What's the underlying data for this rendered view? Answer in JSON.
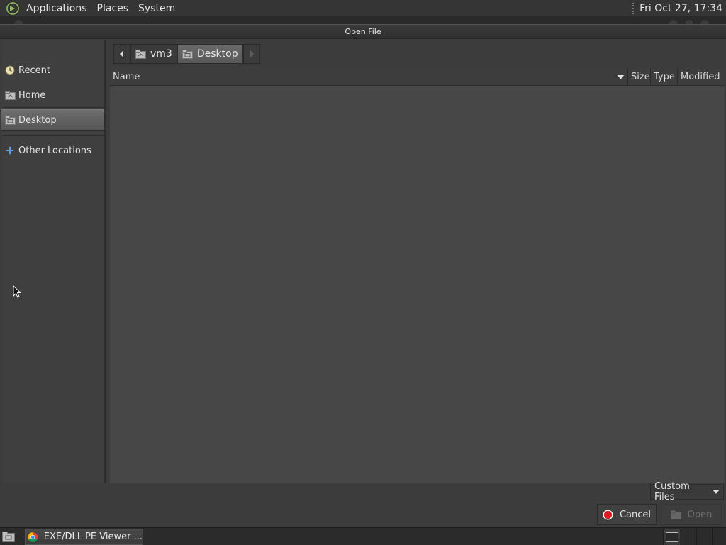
{
  "top_panel": {
    "menus": [
      "Applications",
      "Places",
      "System"
    ],
    "clock": "Fri Oct 27, 17:34"
  },
  "dialog": {
    "title": "Open File",
    "places": [
      {
        "label": "Recent",
        "icon": "recent-icon"
      },
      {
        "label": "Home",
        "icon": "home-folder-icon"
      },
      {
        "label": "Desktop",
        "icon": "desktop-folder-icon",
        "selected": true
      },
      {
        "label": "Other Locations",
        "icon": "plus-icon"
      }
    ],
    "path": [
      "vm3",
      "Desktop"
    ],
    "columns": {
      "name": "Name",
      "size": "Size",
      "type": "Type",
      "modified": "Modified"
    },
    "filter": "Custom Files",
    "cancel_label": "Cancel",
    "open_label": "Open"
  },
  "taskbar": {
    "task_label": "EXE/DLL PE Viewer ..."
  }
}
